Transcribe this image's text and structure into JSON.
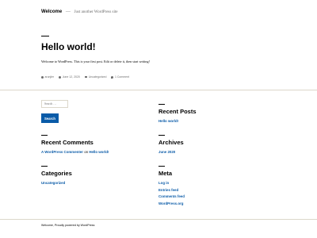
{
  "header": {
    "site_title": "Welcome",
    "dash": "—",
    "tagline": "Just another WordPress site"
  },
  "post": {
    "title": "Hello world!",
    "body": "Welcome to WordPress. This is your first post. Edit or delete it, then start writing!",
    "meta": {
      "author": "arunjler",
      "date": "June 12, 2020",
      "category": "Uncategorized",
      "comments": "1 Comment"
    }
  },
  "search": {
    "placeholder": "Search …",
    "button_label": "Search"
  },
  "recent_posts": {
    "title": "Recent Posts",
    "items": [
      "Hello world!"
    ]
  },
  "recent_comments": {
    "title": "Recent Comments",
    "author": "A WordPress Commenter",
    "on": "on",
    "post": "Hello world!"
  },
  "archives": {
    "title": "Archives",
    "items": [
      "June 2020"
    ]
  },
  "categories": {
    "title": "Categories",
    "items": [
      "Uncategorized"
    ]
  },
  "meta_widget": {
    "title": "Meta",
    "items": [
      "Log in",
      "Entries feed",
      "Comments feed",
      "WordPress.org"
    ]
  },
  "footer": {
    "text": "Welcome, Proudly powered by WordPress"
  },
  "colors": {
    "link": "#0a5ba8",
    "button": "#0a5ba8",
    "rule": "#dcd7ca",
    "muted": "#6d6d6d"
  }
}
